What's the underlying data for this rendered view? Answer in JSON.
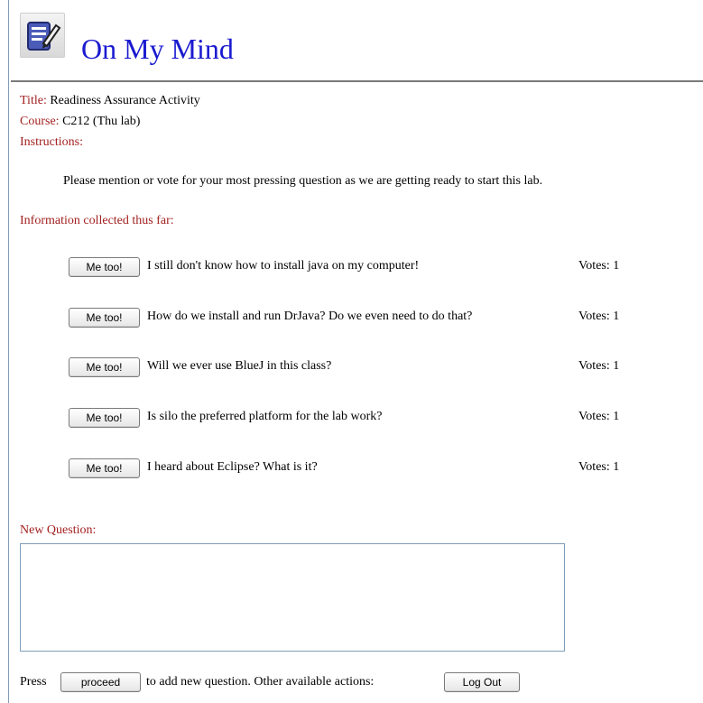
{
  "app": {
    "title": "On My Mind"
  },
  "activity": {
    "title_label": "Title:",
    "title_value": " Readiness Assurance Activity",
    "course_label": "Course:",
    "course_value": " C212 (Thu lab)",
    "instructions_label": "Instructions:",
    "instructions_text": "Please mention or vote for your most pressing question as we are getting ready to start this lab."
  },
  "collected": {
    "label": "Information collected thus far:",
    "button_label": "Me too!",
    "items": [
      {
        "question": "I still don't know how to install java on my computer!",
        "votes": "Votes: 1"
      },
      {
        "question": "How do we install and run DrJava? Do we even need to do that?",
        "votes": "Votes: 1"
      },
      {
        "question": "Will we ever use BlueJ in this class?",
        "votes": "Votes: 1"
      },
      {
        "question": "Is silo the preferred platform for the lab work?",
        "votes": "Votes: 1"
      },
      {
        "question": "I heard about Eclipse? What is it?",
        "votes": "Votes: 1"
      }
    ]
  },
  "new_question": {
    "label": "New Question:",
    "value": ""
  },
  "footer": {
    "press_text": "Press",
    "proceed_label": "proceed",
    "after_text": "to add new question. Other available actions:",
    "logout_label": "Log Out"
  },
  "colors": {
    "title_blue": "#1a1ad0",
    "label_red": "#a32020"
  },
  "icons": {
    "logo": "notepad-pencil-icon"
  }
}
